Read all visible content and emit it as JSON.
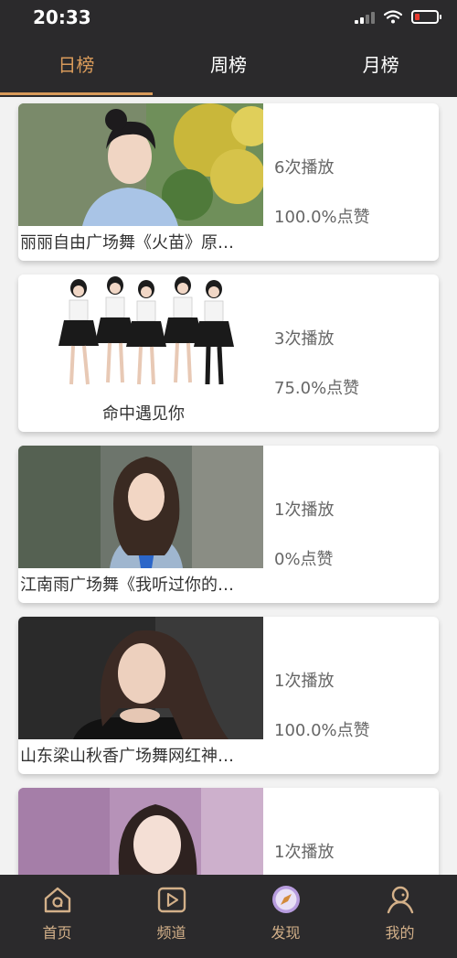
{
  "status": {
    "time": "20:33"
  },
  "tabs": [
    {
      "label": "日榜",
      "active": true
    },
    {
      "label": "周榜",
      "active": false
    },
    {
      "label": "月榜",
      "active": false
    }
  ],
  "items": [
    {
      "title": "丽丽自由广场舞《火苗》原…",
      "plays": "6次播放",
      "likes": "100.0%点赞"
    },
    {
      "title": "命中遇见你",
      "plays": "3次播放",
      "likes": "75.0%点赞"
    },
    {
      "title": "江南雨广场舞《我听过你的…",
      "plays": "1次播放",
      "likes": "0%点赞"
    },
    {
      "title": "山东梁山秋香广场舞网红神…",
      "plays": "1次播放",
      "likes": "100.0%点赞"
    },
    {
      "title": "",
      "plays": "1次播放",
      "likes": ""
    }
  ],
  "nav": [
    {
      "label": "首页",
      "icon": "home-icon"
    },
    {
      "label": "频道",
      "icon": "play-channel-icon"
    },
    {
      "label": "发现",
      "icon": "compass-icon"
    },
    {
      "label": "我的",
      "icon": "user-icon"
    }
  ],
  "colors": {
    "bar": "#2b2a2c",
    "accent": "#d89a5a",
    "nav_label": "#d3b089"
  }
}
